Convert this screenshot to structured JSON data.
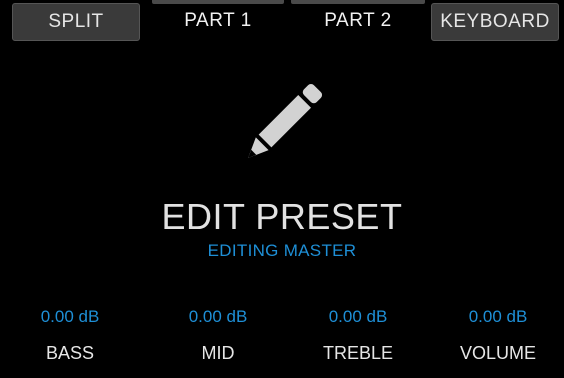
{
  "tabs": [
    {
      "label": "SPLIT",
      "style": "boxed"
    },
    {
      "label": "PART 1",
      "style": "plain"
    },
    {
      "label": "PART 2",
      "style": "plain"
    },
    {
      "label": "KEYBOARD",
      "style": "boxed"
    }
  ],
  "main": {
    "icon": "pencil-icon",
    "title": "EDIT PRESET",
    "subtitle": "EDITING MASTER"
  },
  "params": [
    {
      "value": "0.00 dB",
      "label": "BASS"
    },
    {
      "value": "0.00 dB",
      "label": "MID"
    },
    {
      "value": "0.00 dB",
      "label": "TREBLE"
    },
    {
      "value": "0.00 dB",
      "label": "VOLUME"
    }
  ],
  "colors": {
    "background": "#000000",
    "accent": "#1e8fd6",
    "text": "#e6e6e6",
    "tab_fill": "#3a3a3a"
  }
}
